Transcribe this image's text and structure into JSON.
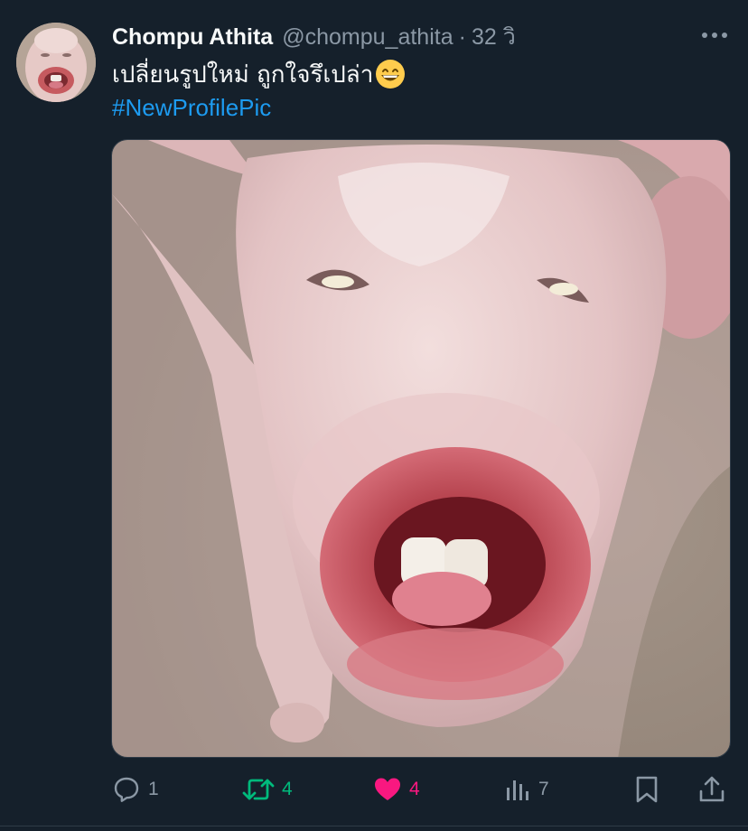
{
  "tweet": {
    "author_name": "Chompu Athita",
    "handle": "@chompu_athita",
    "separator": "·",
    "timestamp": "32 วิ",
    "text": "เปลี่ยนรูปใหม่ ถูกใจรึเปล่า",
    "emoji": "grinning-face-with-smiling-eyes",
    "hashtag": "#NewProfilePic",
    "media_description": "pig"
  },
  "actions": {
    "reply_count": "1",
    "retweet_count": "4",
    "like_count": "4",
    "view_count": "7"
  },
  "colors": {
    "background": "#15202b",
    "text": "#f7f9f9",
    "secondary": "#8b98a5",
    "link": "#1d9bf0",
    "retweet": "#00ba7c",
    "like": "#f91880"
  },
  "icons": [
    "more-icon",
    "reply-icon",
    "retweet-icon",
    "like-icon",
    "views-icon",
    "bookmark-icon",
    "share-icon"
  ]
}
